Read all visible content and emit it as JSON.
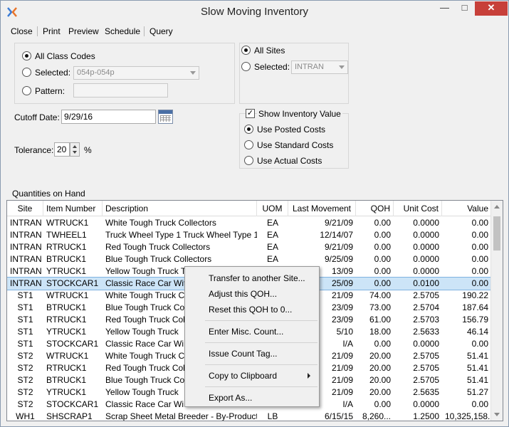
{
  "window": {
    "title": "Slow Moving Inventory"
  },
  "menu": [
    "Close",
    "Print",
    "Preview",
    "Schedule",
    "Query"
  ],
  "class_codes": {
    "all_label": "All Class Codes",
    "selected_label": "Selected:",
    "selected_value": "054p-054p",
    "pattern_label": "Pattern:",
    "pattern_value": ""
  },
  "sites": {
    "all_label": "All Sites",
    "selected_label": "Selected:",
    "selected_value": "INTRAN"
  },
  "cutoff": {
    "label": "Cutoff Date:",
    "value": "9/29/16"
  },
  "tolerance": {
    "label": "Tolerance:",
    "value": "20",
    "unit": "%"
  },
  "costs": {
    "show_label": "Show Inventory Value",
    "posted": "Use Posted Costs",
    "standard": "Use Standard Costs",
    "actual": "Use Actual Costs"
  },
  "table": {
    "section_label": "Quantities on Hand",
    "columns": [
      "Site",
      "Item Number",
      "Description",
      "UOM",
      "Last Movement",
      "QOH",
      "Unit Cost",
      "Value"
    ],
    "rows": [
      [
        "INTRAN",
        "WTRUCK1",
        "White Tough Truck Collectors",
        "EA",
        "9/21/09",
        "0.00",
        "0.0000",
        "0.00"
      ],
      [
        "INTRAN",
        "TWHEEL1",
        "Truck Wheel Type 1 Truck Wheel Type 1",
        "EA",
        "12/14/07",
        "0.00",
        "0.0000",
        "0.00"
      ],
      [
        "INTRAN",
        "RTRUCK1",
        "Red Tough Truck Collectors",
        "EA",
        "9/21/09",
        "0.00",
        "0.0000",
        "0.00"
      ],
      [
        "INTRAN",
        "BTRUCK1",
        "Blue Tough Truck Collectors",
        "EA",
        "9/25/09",
        "0.00",
        "0.0000",
        "0.00"
      ],
      [
        "INTRAN",
        "YTRUCK1",
        "Yellow Tough Truck T",
        "",
        "13/09",
        "0.00",
        "0.0000",
        "0.00"
      ],
      [
        "INTRAN",
        "STOCKCAR1",
        "Classic Race Car With",
        "",
        "25/09",
        "0.00",
        "0.0100",
        "0.00"
      ],
      [
        "ST1",
        "WTRUCK1",
        "White Tough Truck C",
        "",
        "21/09",
        "74.00",
        "2.5705",
        "190.22"
      ],
      [
        "ST1",
        "BTRUCK1",
        "Blue Tough Truck Co",
        "",
        "23/09",
        "73.00",
        "2.5704",
        "187.64"
      ],
      [
        "ST1",
        "RTRUCK1",
        "Red Tough Truck Coll",
        "",
        "23/09",
        "61.00",
        "2.5703",
        "156.79"
      ],
      [
        "ST1",
        "YTRUCK1",
        "Yellow Tough Truck",
        "",
        "5/10",
        "18.00",
        "2.5633",
        "46.14"
      ],
      [
        "ST1",
        "STOCKCAR1",
        "Classic Race Car Wi",
        "",
        "I/A",
        "0.00",
        "0.0000",
        "0.00"
      ],
      [
        "ST2",
        "WTRUCK1",
        "White Tough Truck C",
        "",
        "21/09",
        "20.00",
        "2.5705",
        "51.41"
      ],
      [
        "ST2",
        "RTRUCK1",
        "Red Tough Truck Coll",
        "",
        "21/09",
        "20.00",
        "2.5705",
        "51.41"
      ],
      [
        "ST2",
        "BTRUCK1",
        "Blue Tough Truck Co",
        "",
        "21/09",
        "20.00",
        "2.5705",
        "51.41"
      ],
      [
        "ST2",
        "YTRUCK1",
        "Yellow Tough Truck",
        "",
        "21/09",
        "20.00",
        "2.5635",
        "51.27"
      ],
      [
        "ST2",
        "STOCKCAR1",
        "Classic Race Car Wi",
        "",
        "I/A",
        "0.00",
        "0.0000",
        "0.00"
      ],
      [
        "WH1",
        "SHSCRAP1",
        "Scrap Sheet Metal Breeder - By-Product",
        "LB",
        "6/15/15",
        "8,260...",
        "1.2500",
        "10,325,158..."
      ]
    ]
  },
  "context_menu": [
    "Transfer to another Site...",
    "Adjust this QOH...",
    "Reset this QOH to 0...",
    "Enter Misc. Count...",
    "Issue Count Tag...",
    "Copy to Clipboard",
    "Export As..."
  ],
  "colors": {
    "selection": "#cce4f7",
    "close_button": "#c7403a"
  }
}
